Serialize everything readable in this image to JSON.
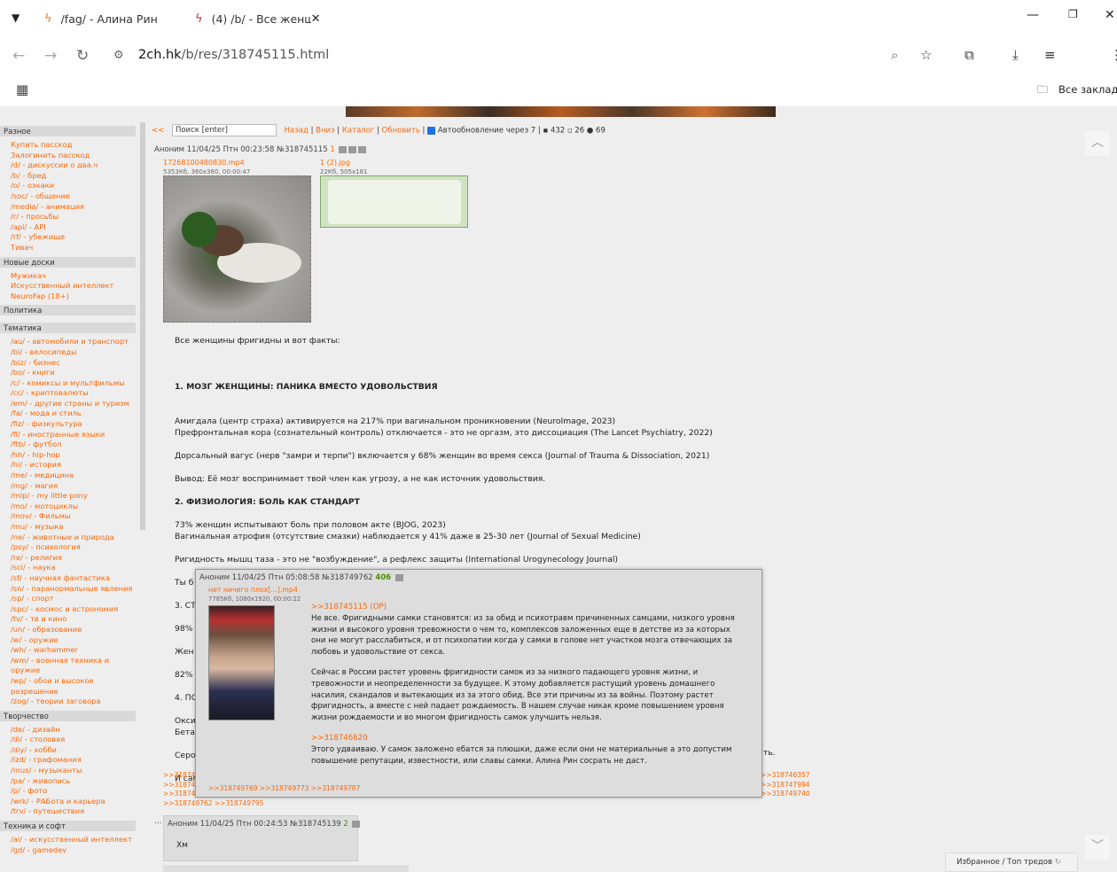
{
  "browser": {
    "tabs": [
      {
        "title": "/fag/ - Алина Рин",
        "icon": "bolt-icon"
      },
      {
        "title": "(4) /b/ - Все женщ",
        "icon": "bolt-notify-icon"
      }
    ],
    "url_host": "2ch.hk",
    "url_path": "/b/res/318745115.html",
    "bookmarks_label": "Все закладки"
  },
  "sidebar": {
    "sections": [
      {
        "title": "Разное",
        "items": [
          "Купить пасскод",
          "Залогинить пасскод",
          "/d/ - дискуссии о два.ч",
          "/b/ - бред",
          "/o/ - оэкаки",
          "/soc/ - общение",
          "/media/ - анимация",
          "/r/ - просьбы",
          "/api/ - API",
          "/rf/ - убежище",
          "Тивач"
        ]
      },
      {
        "title": "Новые доски",
        "items": [
          "Мужикач",
          "Искусственный интеллект",
          "NeuroFap (18+)"
        ]
      },
      {
        "title": "Политика",
        "items": []
      },
      {
        "title": "Тематика",
        "items": [
          "/au/ - автомобили и транспорт",
          "/bi/ - велосипеды",
          "/biz/ - бизнес",
          "/bo/ - книги",
          "/c/ - комиксы и мультфильмы",
          "/cc/ - криптовалюты",
          "/em/ - другие страны и туризм",
          "/fa/ - мода и стиль",
          "/fiz/ - физкультура",
          "/fl/ - иностранные языки",
          "/ftb/ - футбол",
          "/hh/ - hip-hop",
          "/hi/ - история",
          "/me/ - медицина",
          "/mg/ - магия",
          "/mlp/ - my little pony",
          "/mo/ - мотоциклы",
          "/mov/ - Фильмы",
          "/mu/ - музыка",
          "/ne/ - животные и природа",
          "/psy/ - психология",
          "/re/ - религия",
          "/sci/ - наука",
          "/sf/ - научная фантастика",
          "/sn/ - паранормальные явления",
          "/sp/ - спорт",
          "/spc/ - космос и астрономия",
          "/tv/ - тв и кино",
          "/un/ - образование",
          "/w/ - оружие",
          "/wh/ - warhammer",
          "/wm/ - военная техника и",
          "оружие",
          "/wp/ - обои и высокое",
          "разрешение",
          "/zog/ - теории заговора"
        ]
      },
      {
        "title": "Творчество",
        "items": [
          "/de/ - дизайн",
          "/di/ - столовая",
          "/diy/ - хобби",
          "/izd/ - графомания",
          "/mus/ - музыканты",
          "/pa/ - живопись",
          "/p/ - фото",
          "/wrk/ - РАБота и карьера",
          "/trv/ - путешествия"
        ]
      },
      {
        "title": "Техника и софт",
        "items": [
          "/ai/ - искусственный интеллект",
          "/gd/ - gamedev"
        ]
      }
    ]
  },
  "toolbar": {
    "back_arrows": "<<",
    "search_placeholder": "Поиск [enter]",
    "links": [
      "Назад",
      "Вниз",
      "Каталог",
      "Обновить"
    ],
    "autoupdate": "Автообновление через 7",
    "posts_count": "432",
    "images_count": "26",
    "posters_count": "69"
  },
  "op": {
    "header": "Аноним 11/04/25 Птн 00:23:58 №318745115",
    "number": "1",
    "files": [
      {
        "name": "17268100480830.mp4",
        "meta": "5353Кб, 360x360, 00:00:47"
      },
      {
        "name": "1 (2).jpg",
        "meta": "22Кб, 505x181"
      }
    ],
    "paragraphs": [
      "Все женщины фригидны и вот факты:",
      "",
      "1. МОЗГ ЖЕНЩИНЫ: ПАНИКА ВМЕСТО УДОВОЛЬСТВИЯ",
      "Амигдала (центр страха) активируется на 217% при вагинальном проникновении (NeuroImage, 2023)",
      "Префронтальная кора (сознательный контроль) отключается - это не оргазм, это диссоциация (The Lancet Psychiatry, 2022)",
      "Дорсальный вагус (нерв \"замри и терпи\") включается у 68% женщин во время секса (Journal of Trauma & Dissociation, 2021)",
      "Вывод: Её мозг воспринимает твой член как угрозу, а не как источник удовольствия.",
      "2. ФИЗИОЛОГИЯ: БОЛЬ КАК СТАНДАРТ",
      "73% женщин испытывают боль при половом акте (BJOG, 2023)",
      "Вагинальная атрофия (отсутствие смазки) наблюдается у 41% даже в 25-30 лет (Journal of Sexual Medicine)",
      "Ригидность мышц таза - это не \"возбуждение\", а рефлекс защиты (International Urogynecology Journal)",
      "Ты б",
      "3. СТ",
      "98% ",
      "Жен",
      "82% ",
      "4. ПО",
      "Окси",
      "Бета",
      "Серо",
      "И сам",
      "ть."
    ],
    "replies_left": [
      ">>3187451",
      ">>318746",
      ">>318748",
      ">>318749762 >>318749795"
    ],
    "replies_right": [
      ">>318746357",
      ">>318747994",
      ">>318749740"
    ]
  },
  "popup": {
    "header": "Аноним 11/04/25 Птн 05:08:58 №318749762",
    "number": "406",
    "file_name": "нет ничего плох[...].mp4",
    "file_meta": "7785Кб, 1080x1920, 00:00:22",
    "quote1": ">>318745115 (OP)",
    "para1": "Не все. Фригидными самки становятся: из за обид и психотравм причиненных самцами, низкого уровня жизни и высокого уровня тревожности о чем то, комплексов заложенных еще в детстве из за которых они не могут расслабиться, и от психопатии когда у самки в голове нет участков мозга отвечающих за любовь и удовольствие от секса.",
    "para2": "Сейчас в России растет уровень фригидности самок из за низкого падающего уровня жизни, и тревожности и неопределенности за будущее. К этому добавляется растущий уровень домашнего насилия, скандалов и вытекающих из за этого обид. Все эти причины из за войны. Поэтому растет фригидность, а вместе с ней падает рождаемость. В нашем случае никак кроме повышением уровня жизни рождаемости и во многом фригидность самок улучшить нельзя.",
    "quote2": ">>318746620",
    "para3": "Этого удваиваю. У самок заложено ебатся за плюшки, даже если они не материальные а это допустим повышение репутации, известности, или славы самки. Алина Рин сосрать не даст.",
    "replies": ">>318749769 >>318749773 >>318749787"
  },
  "post2": {
    "header": "Аноним 11/04/25 Птн 00:24:53 №318745139",
    "number": "2",
    "text": "Хм"
  },
  "footer": {
    "favorites": "Избранное / Топ тредов"
  }
}
